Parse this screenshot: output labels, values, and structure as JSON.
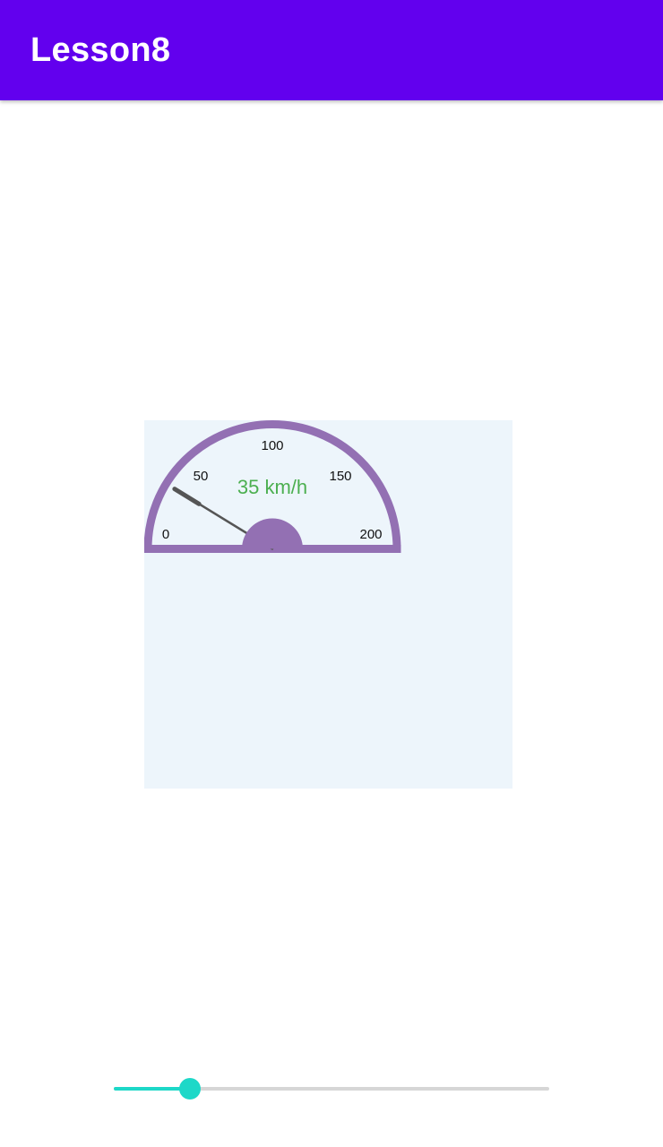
{
  "app_bar": {
    "title": "Lesson8",
    "color": "#6200EE"
  },
  "gauge": {
    "min": 0,
    "max": 200,
    "value": 35,
    "ticks": [
      "0",
      "50",
      "100",
      "150",
      "200"
    ],
    "readout": "35 km/h",
    "colors": {
      "panel_background": "#EDF5FB",
      "arc": "#9370B3",
      "needle": "#555555",
      "readout_text": "#4CAF50"
    }
  },
  "slider": {
    "value_fraction": 0.175,
    "colors": {
      "active": "#1DD8C8",
      "inactive": "#D6D6D6"
    }
  }
}
